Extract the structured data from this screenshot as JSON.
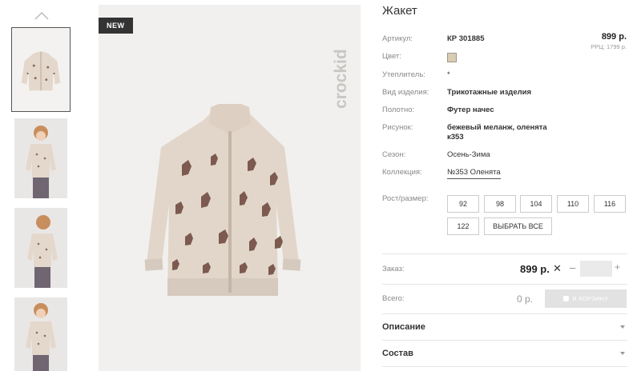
{
  "gallery": {
    "badge": "NEW",
    "brand": "crockid"
  },
  "product": {
    "title": "Жакет",
    "price": "899 р.",
    "rrp": "РРЦ: 1799 р.",
    "color_hex": "#d9ccb2"
  },
  "attributes": [
    {
      "label": "Артикул:",
      "value": "КР 301885"
    },
    {
      "label": "Цвет:",
      "value": ""
    },
    {
      "label": "Утеплитель:",
      "value": "*"
    },
    {
      "label": "Вид изделия:",
      "value": "Трикотажные изделия"
    },
    {
      "label": "Полотно:",
      "value": "Футер начес"
    },
    {
      "label": "Рисунок:",
      "value": "бежевый меланж, оленята",
      "value2": "к353"
    },
    {
      "label": "Сезон:",
      "value": "Осень-Зима"
    },
    {
      "label": "Коллекция:",
      "value": "№353 Оленята"
    }
  ],
  "sizes": {
    "label": "Рост/размер:",
    "options": [
      "92",
      "98",
      "104",
      "110",
      "116",
      "122"
    ],
    "select_all": "ВЫБРАТЬ ВСЕ"
  },
  "order": {
    "label": "Заказ:",
    "price": "899 р.",
    "times": "✕",
    "minus": "–",
    "plus": "+",
    "quantity": ""
  },
  "total": {
    "label": "Всего:",
    "value": "0 р.",
    "cart_button": "В КОРЗИНУ"
  },
  "accordion": [
    {
      "title": "Описание"
    },
    {
      "title": "Состав"
    }
  ]
}
